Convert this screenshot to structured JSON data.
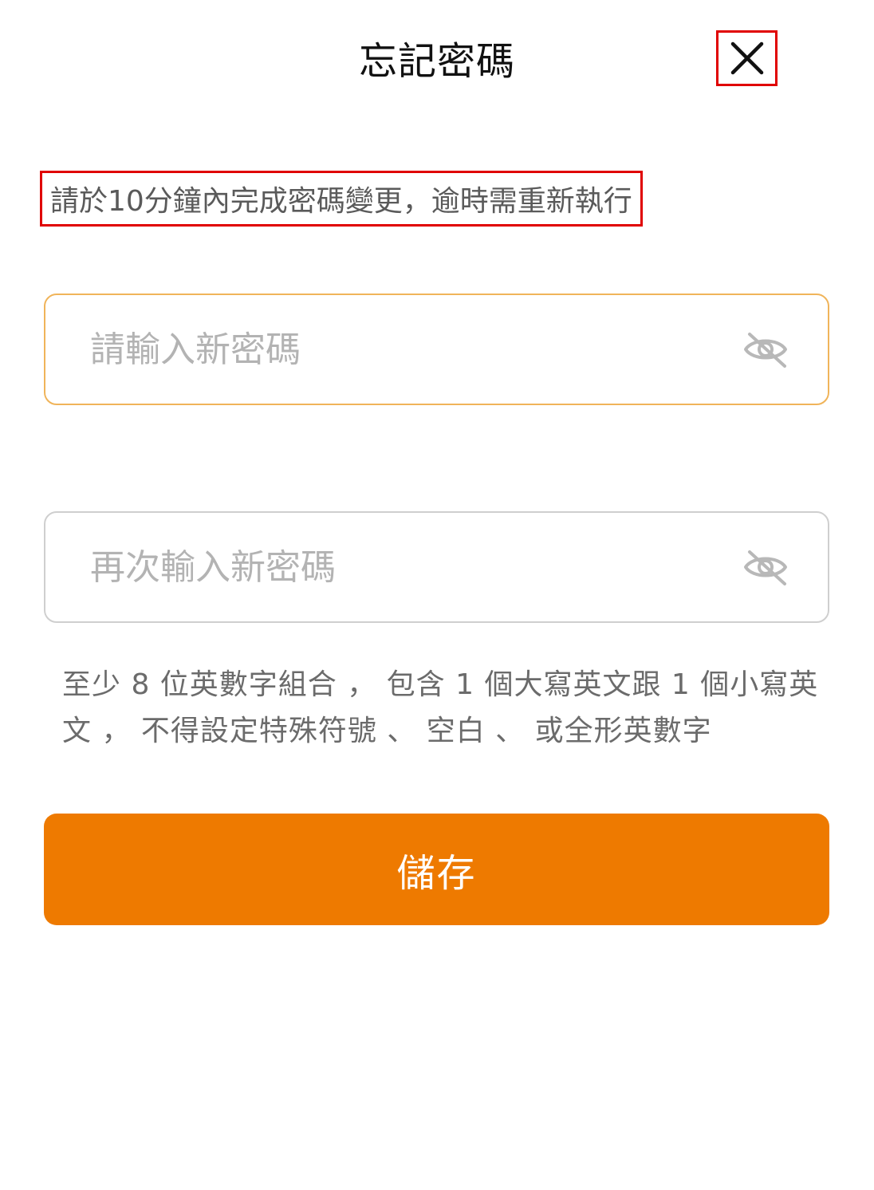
{
  "header": {
    "title": "忘記密碼",
    "close_icon": "close-icon"
  },
  "notice": {
    "text": "請於10分鐘內完成密碼變更，逾時需重新執行"
  },
  "form": {
    "new_password": {
      "value": "",
      "placeholder": "請輸入新密碼",
      "toggle_icon": "eye-off-icon"
    },
    "confirm_password": {
      "value": "",
      "placeholder": "再次輸入新密碼",
      "toggle_icon": "eye-off-icon"
    },
    "hint": "至少 8 位英數字組合 ， 包含 1 個大寫英文跟 1 個小寫英文 ， 不得設定特殊符號 、 空白 、 或全形英數字",
    "save_label": "儲存"
  },
  "colors": {
    "accent": "#ee7a00",
    "focus_border": "#f0b45a",
    "idle_border": "#cfcfcf",
    "highlight_box": "#e00000",
    "placeholder": "#b3b3b3"
  }
}
